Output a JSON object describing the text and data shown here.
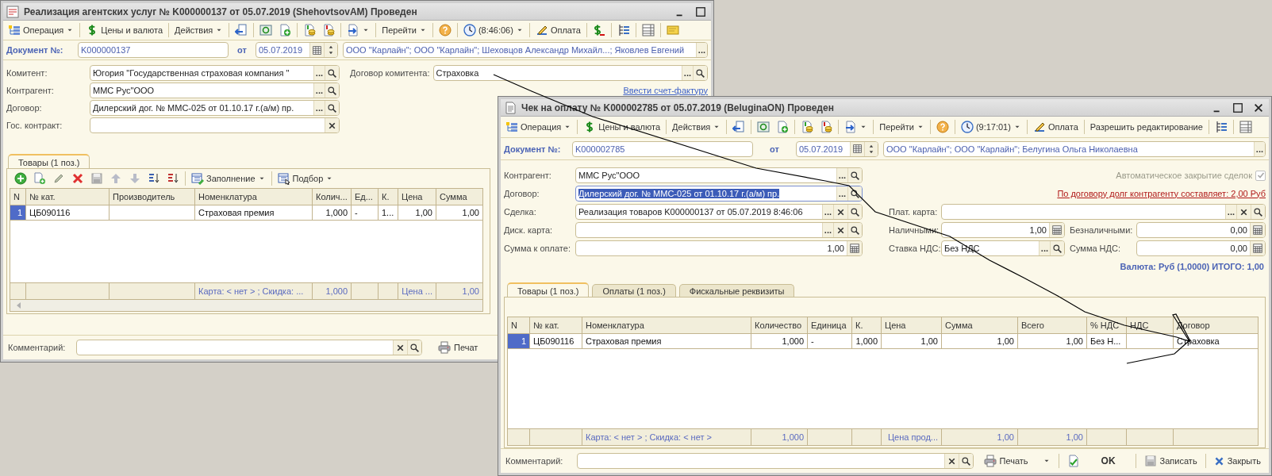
{
  "windows": [
    {
      "title": "Реализация агентских услуг № K000000137 от 05.07.2019 (ShehovtsovAM) Проведен",
      "close_button": false,
      "toolbar": [
        {
          "kind": "icon_text_menu",
          "label": "Операция"
        },
        {
          "kind": "separator"
        },
        {
          "kind": "icon_button",
          "label": "Цены и валюта"
        },
        {
          "kind": "separator"
        },
        {
          "kind": "menu",
          "label": "Действия"
        },
        {
          "kind": "separator"
        },
        {
          "kind": "icon"
        },
        {
          "kind": "separator"
        },
        {
          "kind": "icon"
        },
        {
          "kind": "icon"
        },
        {
          "kind": "separator"
        },
        {
          "kind": "icon"
        },
        {
          "kind": "icon"
        },
        {
          "kind": "separator"
        },
        {
          "kind": "icon_menu"
        },
        {
          "kind": "separator"
        },
        {
          "kind": "menu",
          "label": "Перейти"
        },
        {
          "kind": "separator"
        },
        {
          "kind": "icon"
        },
        {
          "kind": "separator"
        },
        {
          "kind": "icon_text_menu",
          "label": "(8:46:06)"
        },
        {
          "kind": "separator"
        },
        {
          "kind": "icon_button",
          "label": "Оплата"
        },
        {
          "kind": "separator"
        },
        {
          "kind": "icon"
        },
        {
          "kind": "separator"
        },
        {
          "kind": "icon"
        },
        {
          "kind": "separator"
        },
        {
          "kind": "icon"
        },
        {
          "kind": "separator"
        },
        {
          "kind": "icon"
        }
      ],
      "document": {
        "label": "Документ №:",
        "number": "K000000137",
        "date_label": "от",
        "date": "05.07.2019",
        "organization": "ООО \"Карлайн\"; ООО \"Карлайн\"; Шеховцов Александр Михайл...; Яковлев Евгений",
        "choose": "..."
      },
      "rows": [
        [
          {
            "kind": "field",
            "label": "Комитент:",
            "value": "Югория \"Государственная страховая компания \"",
            "choose": "...",
            "clear": false,
            "search": true,
            "selected": false
          },
          {
            "kind": "field",
            "label": "Договор комитента:",
            "value": "Страховка",
            "choose": "...",
            "clear": false,
            "search": true,
            "selected": false
          }
        ],
        [
          {
            "kind": "field",
            "label": "Контрагент:",
            "value": "ММС Рус\"ООО",
            "choose": "...",
            "clear": false,
            "search": true,
            "selected": false
          },
          {
            "kind": "link",
            "label": "Ввести счет-фактуру"
          }
        ],
        [
          {
            "kind": "field",
            "label": "Договор:",
            "value": "Дилерский дог. № ММС-025 от 01.10.17 г.(а/м) пр.",
            "choose": "...",
            "clear": false,
            "search": true,
            "selected": false
          }
        ],
        [
          {
            "kind": "field",
            "label": "Гос. контракт:",
            "clear": true,
            "search": false,
            "selected": false
          }
        ]
      ],
      "tabs": [
        {
          "label": "Товары (1 поз.)",
          "selected": true
        }
      ],
      "table_toolbar": [
        {
          "kind": "icon"
        },
        {
          "kind": "icon"
        },
        {
          "kind": "icon"
        },
        {
          "kind": "icon"
        },
        {
          "kind": "icon"
        },
        {
          "kind": "icon"
        },
        {
          "kind": "icon"
        },
        {
          "kind": "icon"
        },
        {
          "kind": "icon"
        },
        {
          "kind": "separator"
        },
        {
          "kind": "icon_text_menu",
          "label": "Заполнение"
        },
        {
          "kind": "separator"
        },
        {
          "kind": "icon_text_menu",
          "label": "Подбор"
        }
      ],
      "table": {
        "columns": [
          {
            "label": "N",
            "values": [
              "1"
            ]
          },
          {
            "label": "№ кат.",
            "values": [
              "ЦБ090116"
            ]
          },
          {
            "label": "Производитель"
          },
          {
            "label": "Номенклатура",
            "values": [
              "Страховая премия"
            ],
            "footer": "Карта:  < нет > ; Скидка:  ..."
          },
          {
            "label": "Колич...",
            "values": [
              "1,000"
            ],
            "footer": "1,000"
          },
          {
            "label": "Ед...",
            "values": [
              "-"
            ]
          },
          {
            "label": "К.",
            "values": [
              "1..."
            ]
          },
          {
            "label": "Цена",
            "values": [
              "1,00"
            ],
            "footer": "Цена ..."
          },
          {
            "label": "Сумма",
            "values": [
              "1,00"
            ],
            "footer": "1,00"
          }
        ],
        "rows": [
          {
            "selected": true
          }
        ],
        "horizontal_scrollbar": true
      },
      "comment": {
        "label": "Комментарий:",
        "clear": true,
        "search": true
      },
      "buttons": [
        {
          "kind": "print",
          "label": "Печат"
        }
      ]
    },
    {
      "title": "Чек на оплату № K000002785 от 05.07.2019 (BeluginaON) Проведен",
      "close_button": true,
      "toolbar": [
        {
          "kind": "icon_text_menu",
          "label": "Операция"
        },
        {
          "kind": "separator"
        },
        {
          "kind": "icon_button",
          "label": "Цены и валюта"
        },
        {
          "kind": "separator"
        },
        {
          "kind": "menu",
          "label": "Действия"
        },
        {
          "kind": "separator"
        },
        {
          "kind": "icon"
        },
        {
          "kind": "separator"
        },
        {
          "kind": "icon"
        },
        {
          "kind": "icon"
        },
        {
          "kind": "separator"
        },
        {
          "kind": "icon"
        },
        {
          "kind": "icon"
        },
        {
          "kind": "separator"
        },
        {
          "kind": "icon_menu"
        },
        {
          "kind": "separator"
        },
        {
          "kind": "menu",
          "label": "Перейти"
        },
        {
          "kind": "separator"
        },
        {
          "kind": "icon"
        },
        {
          "kind": "separator"
        },
        {
          "kind": "icon_text_menu",
          "label": "(9:17:01)"
        },
        {
          "kind": "separator"
        },
        {
          "kind": "icon_button",
          "label": "Оплата"
        },
        {
          "kind": "separator"
        },
        {
          "kind": "button",
          "label": "Разрешить редактирование"
        },
        {
          "kind": "separator"
        },
        {
          "kind": "icon"
        },
        {
          "kind": "separator"
        },
        {
          "kind": "icon"
        }
      ],
      "document": {
        "label": "Документ №:",
        "number": "K000002785",
        "date_label": "от",
        "date": "05.07.2019",
        "organization": "ООО \"Карлайн\"; ООО \"Карлайн\"; Белугина Ольга Николаевна",
        "choose": "..."
      },
      "rows": [
        [
          {
            "kind": "field",
            "label": "Контрагент:",
            "value": "ММС Рус\"ООО",
            "choose": "...",
            "clear": false,
            "search": true,
            "selected": false
          },
          {
            "kind": "checkbox",
            "label": "Автоматическое закрытие сделок",
            "checked": true,
            "disabled": true
          }
        ],
        [
          {
            "kind": "field",
            "label": "Договор:",
            "value": "Дилерский дог. № ММС-025 от 01.10.17 г.(а/м) пр.",
            "choose": "...",
            "clear": false,
            "search": true,
            "selected": true
          },
          {
            "kind": "warning_link",
            "label": "По договору долг контрагенту составляет: 2,00 Руб"
          }
        ],
        [
          {
            "kind": "field",
            "label": "Сделка:",
            "value": "Реализация товаров K000000137 от 05.07.2019 8:46:06",
            "choose": "...",
            "clear": true,
            "search": true,
            "selected": false
          },
          {
            "kind": "field",
            "label": "Плат. карта:",
            "choose": "...",
            "clear": true,
            "search": true,
            "selected": false
          }
        ],
        [
          {
            "kind": "field",
            "label": "Диск. карта:",
            "choose": "...",
            "clear": true,
            "search": true,
            "selected": false
          },
          {
            "kind": "number",
            "label": "Наличными:",
            "value": "1,00"
          },
          {
            "kind": "number",
            "label": "Безналичными:",
            "value": "0,00"
          }
        ],
        [
          {
            "kind": "number",
            "label": "Сумма к оплате:",
            "value": "1,00"
          },
          {
            "kind": "field",
            "label": "Ставка НДС:",
            "value": "Без НДС",
            "choose": "...",
            "clear": false,
            "search": true,
            "selected": false
          },
          {
            "kind": "number",
            "label": "Сумма НДС:",
            "value": "0,00"
          }
        ]
      ],
      "total": {
        "kind": "total",
        "label": "Валюта: Руб (1,0000) ИТОГО: 1,00"
      },
      "tabs": [
        {
          "label": "Товары (1 поз.)",
          "selected": true
        },
        {
          "label": "Оплаты (1 поз.)",
          "selected": false
        },
        {
          "label": "Фискальные реквизиты",
          "selected": false
        }
      ],
      "table": {
        "columns": [
          {
            "label": "N",
            "values": [
              "1"
            ]
          },
          {
            "label": "№ кат.",
            "values": [
              "ЦБ090116"
            ]
          },
          {
            "label": "Номенклатура",
            "values": [
              "Страховая премия"
            ],
            "footer": "Карта:  < нет > ; Скидка:  < нет >"
          },
          {
            "label": "Количество",
            "values": [
              "1,000"
            ],
            "footer": "1,000"
          },
          {
            "label": "Единица",
            "values": [
              "-"
            ]
          },
          {
            "label": "К.",
            "values": [
              "1,000"
            ]
          },
          {
            "label": "Цена",
            "values": [
              "1,00"
            ],
            "footer": "Цена прод..."
          },
          {
            "label": "Сумма",
            "values": [
              "1,00"
            ],
            "footer": "1,00"
          },
          {
            "label": "Всего",
            "values": [
              "1,00"
            ],
            "footer": "1,00"
          },
          {
            "label": "% НДС",
            "values": [
              "Без Н..."
            ]
          },
          {
            "label": "НДС"
          },
          {
            "label": "Договор",
            "values": [
              "Страховка"
            ]
          }
        ],
        "rows": [
          {
            "selected": true
          }
        ],
        "horizontal_scrollbar": false
      },
      "comment": {
        "label": "Комментарий:",
        "clear": true,
        "search": true
      },
      "buttons": [
        {
          "kind": "print_menu",
          "label": "Печать"
        },
        {
          "kind": "check"
        },
        {
          "kind": "default",
          "label": "OK"
        },
        {
          "kind": "save",
          "label": "Записать"
        },
        {
          "kind": "close",
          "label": "Закрыть"
        }
      ]
    }
  ]
}
